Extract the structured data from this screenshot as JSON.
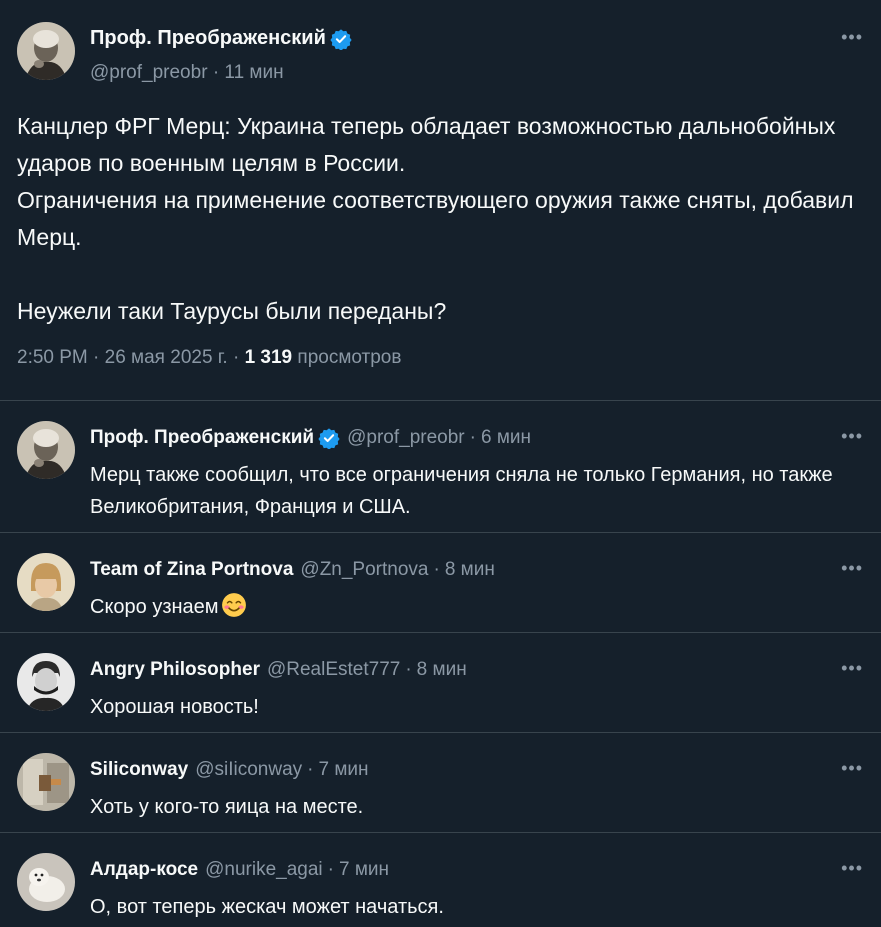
{
  "colors": {
    "background": "#15202b",
    "text": "#f7f9f9",
    "secondary_text": "#8b98a5",
    "divider": "#38444d",
    "verified_badge": "#1d9bf0"
  },
  "main_tweet": {
    "author_name": "Проф. Преображенский",
    "verified": true,
    "handle": "@prof_preobr",
    "separator": "·",
    "time_ago": "11 мин",
    "text": "Канцлер ФРГ Мерц: Украина теперь обладает возможностью дальнобойных ударов по военным целям в России.\nОграничения на применение соответствующего оружия также сняты, добавил Мерц.\n\nНеужели таки Таурусы были переданы?",
    "timestamp": "2:50 PM · 26 мая 2025 г. ·",
    "views_count": "1 319",
    "views_label": "просмотров",
    "more_icon": "more-horizontal-icon"
  },
  "replies": [
    {
      "author_name": "Проф. Преображенский",
      "verified": true,
      "handle": "@prof_preobr",
      "separator": "·",
      "time_ago": "6 мин",
      "text": "Мерц также сообщил, что все ограничения сняла не только Германия, но также Великобритания, Франция и США.",
      "emoji": ""
    },
    {
      "author_name": "Team of Zina Portnova",
      "verified": false,
      "handle": "@Zn_Portnova",
      "separator": "·",
      "time_ago": "8 мин",
      "text": "Скоро узнаем",
      "emoji": "smiling-face-emoji"
    },
    {
      "author_name": "Angry Philosopher",
      "verified": false,
      "handle": "@RealEstet777",
      "separator": "·",
      "time_ago": "8 мин",
      "text": "Хорошая новость!",
      "emoji": ""
    },
    {
      "author_name": "Siliconway",
      "verified": false,
      "handle": "@siIiconway",
      "separator": "·",
      "time_ago": "7 мин",
      "text": "Хоть у кого-то яица на месте.",
      "emoji": ""
    },
    {
      "author_name": "Алдар-косе",
      "verified": false,
      "handle": "@nurike_agai",
      "separator": "·",
      "time_ago": "7 мин",
      "text": "О, вот теперь жескач  может начаться.",
      "emoji": ""
    }
  ]
}
